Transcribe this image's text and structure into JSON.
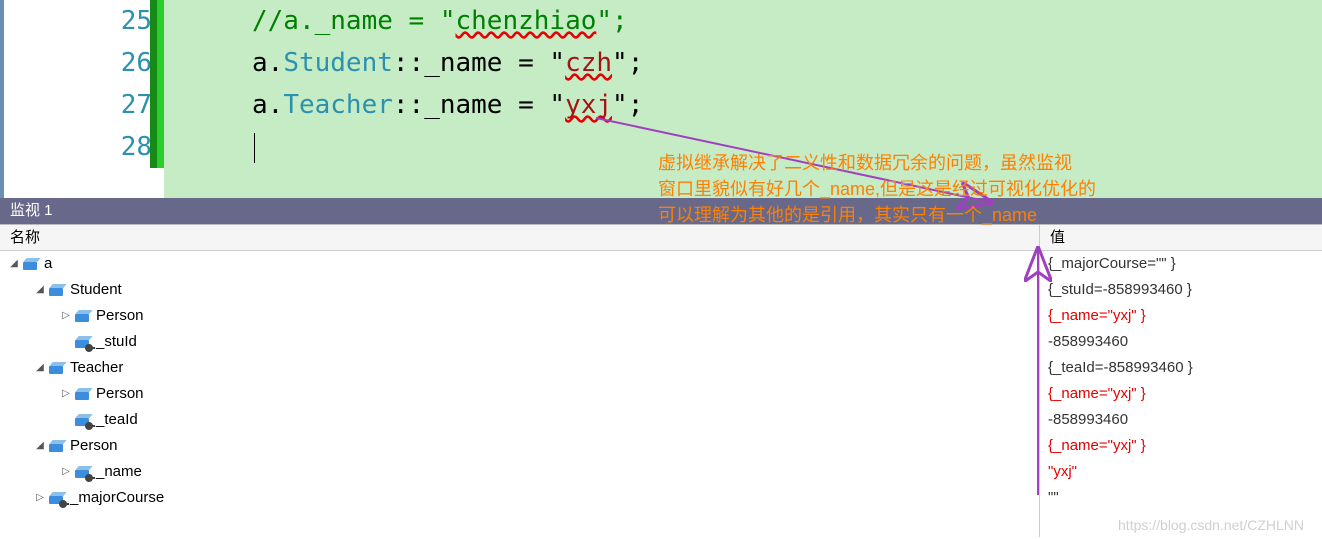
{
  "code": {
    "lines": [
      {
        "num": "25",
        "comment": "//a._name = \"",
        "squig": "chenzhiao",
        "tail": "\";"
      },
      {
        "num": "26",
        "pre": "a.",
        "type": "Student",
        "mid": "::_name = \"",
        "str": "czh",
        "post": "\";"
      },
      {
        "num": "27",
        "pre": "a.",
        "type": "Teacher",
        "mid": "::_name = \"",
        "str": "yxj",
        "post": "\";"
      },
      {
        "num": "28"
      }
    ]
  },
  "annotation": {
    "l1": "虚拟继承解决了二义性和数据冗余的问题，虽然监视",
    "l2": "窗口里貌似有好几个_name,但是这是经过可视化优化的",
    "l3": "可以理解为其他的是引用，其实只有一个_name"
  },
  "panel_title": "监视 1",
  "headers": {
    "name": "名称",
    "value": "值"
  },
  "names": [
    {
      "d": 0,
      "t": "down",
      "k": "cube",
      "label": "a"
    },
    {
      "d": 1,
      "t": "down",
      "k": "cube",
      "label": "Student"
    },
    {
      "d": 2,
      "t": "right",
      "k": "cube",
      "label": "Person"
    },
    {
      "d": 2,
      "t": "",
      "k": "cubekey",
      "label": "_stuId"
    },
    {
      "d": 1,
      "t": "down",
      "k": "cube",
      "label": "Teacher"
    },
    {
      "d": 2,
      "t": "right",
      "k": "cube",
      "label": "Person"
    },
    {
      "d": 2,
      "t": "",
      "k": "cubekey",
      "label": "_teaId"
    },
    {
      "d": 1,
      "t": "down",
      "k": "cube",
      "label": "Person"
    },
    {
      "d": 2,
      "t": "right",
      "k": "cubekey",
      "label": "_name"
    },
    {
      "d": 1,
      "t": "right",
      "k": "cubekey",
      "label": "_majorCourse"
    }
  ],
  "values": [
    {
      "t": "{_majorCourse=\"\" }",
      "c": "grey"
    },
    {
      "t": "{_stuId=-858993460 }",
      "c": "grey"
    },
    {
      "t": "{_name=\"yxj\" }",
      "c": "red"
    },
    {
      "t": "-858993460",
      "c": "grey"
    },
    {
      "t": "{_teaId=-858993460 }",
      "c": "grey"
    },
    {
      "t": "{_name=\"yxj\" }",
      "c": "red"
    },
    {
      "t": "-858993460",
      "c": "grey"
    },
    {
      "t": "{_name=\"yxj\" }",
      "c": "red"
    },
    {
      "t": "\"yxj\"",
      "c": "red"
    },
    {
      "t": "\"\"",
      "c": "grey"
    }
  ],
  "watermark": "https://blog.csdn.net/CZHLNN"
}
